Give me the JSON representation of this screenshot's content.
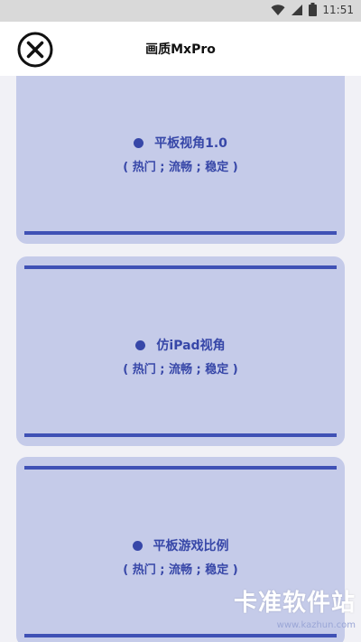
{
  "status_bar": {
    "time": "11:51"
  },
  "app_bar": {
    "title": "画质MxPro"
  },
  "cards": [
    {
      "title": "平板视角1.0",
      "subtitle": "( 热门 ; 流畅 ; 稳定 )"
    },
    {
      "title": "仿iPad视角",
      "subtitle": "( 热门 ; 流畅 ; 稳定 )"
    },
    {
      "title": "平板游戏比例",
      "subtitle": "( 热门 ; 流畅 ; 稳定 )"
    }
  ],
  "watermark": {
    "main": "卡准软件站",
    "sub": "www.kazhun.com"
  },
  "colors": {
    "accent": "#3f51b5",
    "card_bg": "#c5cbe9",
    "text_accent": "#3747a8"
  }
}
